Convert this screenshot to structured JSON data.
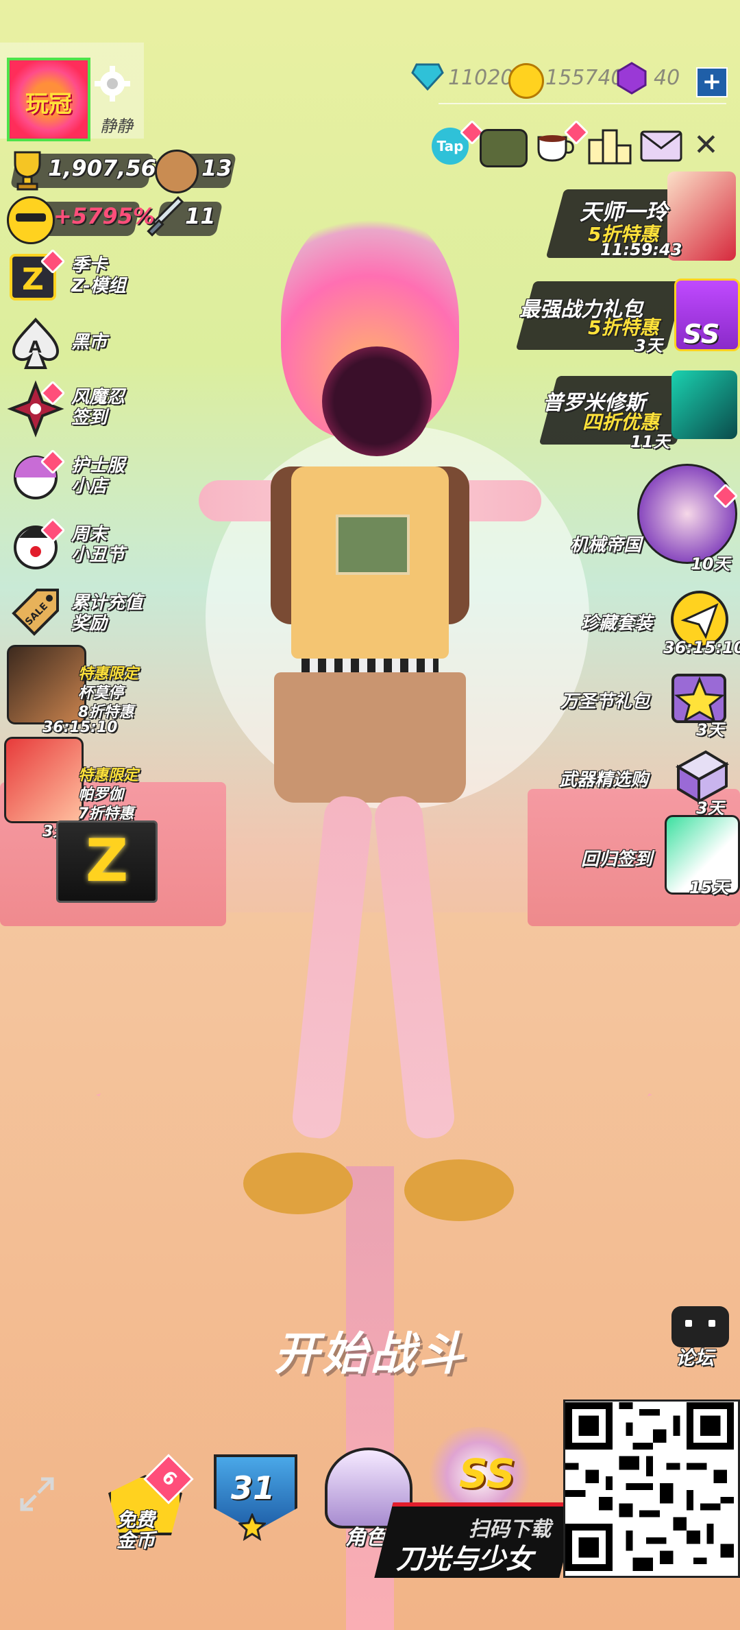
{
  "currency": {
    "diamond_value": "11020",
    "gold_value": "155740",
    "purple_value": "40",
    "add_symbol": "+"
  },
  "profile": {
    "avatar_text": "玩冠",
    "signature": "静静"
  },
  "stats": {
    "trophies": "1,907,564",
    "bears": "13",
    "bonus": "+5795%",
    "weapons": "11"
  },
  "left_menu": [
    {
      "label": "季卡\nZ-模组",
      "icon": "z-card-icon"
    },
    {
      "label": "黑市",
      "icon": "spade-icon"
    },
    {
      "label": "风魔忍\n签到",
      "icon": "shuriken-icon"
    },
    {
      "label": "护士服\n小店",
      "icon": "capsule-icon"
    },
    {
      "label": "周末\n小丑节",
      "icon": "clown-icon"
    },
    {
      "label": "累计充值\n奖励",
      "icon": "sale-tag-icon"
    }
  ],
  "left_promos": [
    {
      "title": "特惠限定",
      "name": "杯莫停",
      "discount": "8折特惠",
      "timer": "36:15:10"
    },
    {
      "title": "特惠限定",
      "name": "帕罗伽",
      "discount": "7折特惠",
      "timer": "3天"
    }
  ],
  "top_icons": {
    "tap_label": "Tap",
    "close_symbol": "✕"
  },
  "right_promos": [
    {
      "title": "天师一玲",
      "sub": "5折特惠",
      "timer": "11:59:43"
    },
    {
      "title": "最强战力礼包",
      "sub": "5折特惠",
      "timer": "3天",
      "badge": "SS"
    },
    {
      "title": "普罗米修斯",
      "sub": "四折优惠",
      "timer": "11天"
    }
  ],
  "right_menu": [
    {
      "label": "机械帝国",
      "timer": "10天"
    },
    {
      "label": "珍藏套装",
      "timer": "36:15:10"
    },
    {
      "label": "万圣节礼包",
      "timer": "3天"
    },
    {
      "label": "武器精选购",
      "timer": "3天"
    },
    {
      "label": "回归签到",
      "timer": "15天"
    }
  ],
  "main": {
    "start_battle": "开始战斗",
    "forum": "论坛",
    "z_logo": "Z"
  },
  "bottom_bar": {
    "free_gold_line1": "免费",
    "free_gold_line2": "金币",
    "free_gold_badge": "6",
    "level": "31",
    "role_label": "角色",
    "ss_label": "SS",
    "scan_text": "扫码下载",
    "game_title": "刀光与少女"
  },
  "colors": {
    "accent_pink": "#ff4e7a",
    "gold": "#ffd21f",
    "purple": "#9a39d6",
    "teal": "#2fc1d8"
  }
}
